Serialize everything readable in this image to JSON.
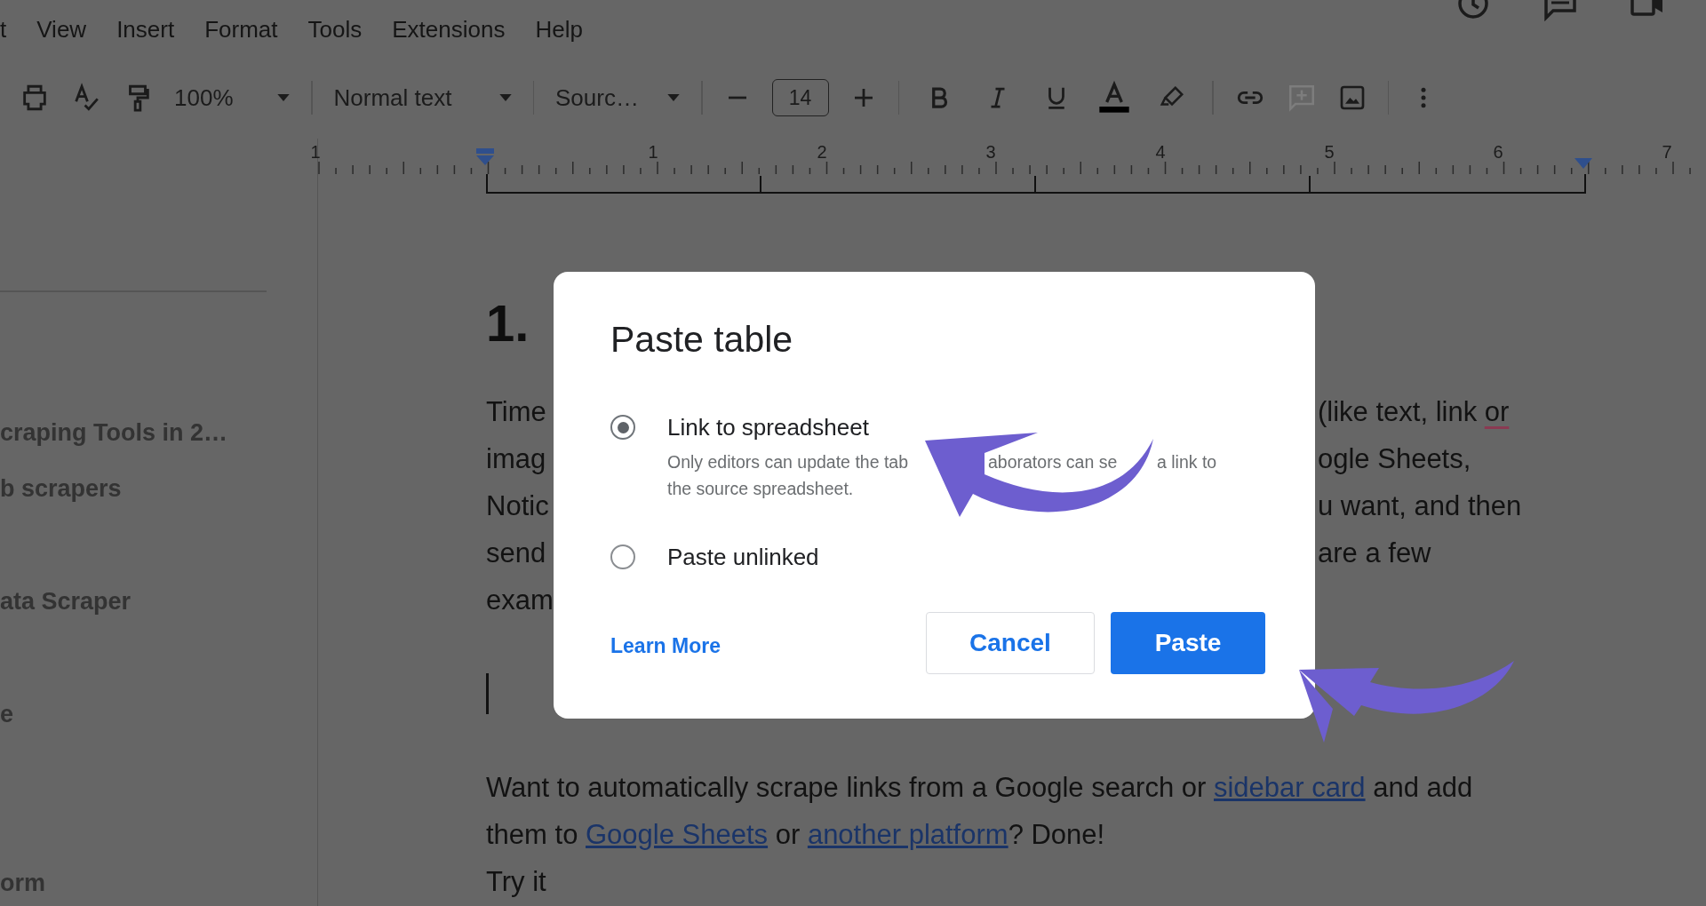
{
  "menu": [
    "t",
    "View",
    "Insert",
    "Format",
    "Tools",
    "Extensions",
    "Help"
  ],
  "toolbar": {
    "zoom": "100%",
    "style": "Normal text",
    "font": "Sourc…",
    "font_size": "14"
  },
  "ruler": {
    "labels": [
      "1",
      "1",
      "2",
      "3",
      "4",
      "5",
      "6",
      "7"
    ]
  },
  "outline": [
    "craping Tools in 2…",
    "b scrapers",
    "ata Scraper",
    "e",
    "orm"
  ],
  "document": {
    "heading": "1.",
    "covered_lines": [
      {
        "left": "Time",
        "right": [
          {
            "text": "(like text, link ",
            "misspelled": false
          },
          {
            "text": "or",
            "misspelled": true
          }
        ]
      },
      {
        "left": "imag",
        "right": [
          {
            "text": "ogle Sheets,",
            "misspelled": false
          }
        ]
      },
      {
        "left": "Notic",
        "right": [
          {
            "text": "u want, and then",
            "misspelled": false
          }
        ]
      },
      {
        "left": "send",
        "right": [
          {
            "text": "are a few",
            "misspelled": false
          }
        ]
      },
      {
        "left": "exam"
      }
    ],
    "lines": [
      [
        {
          "text": "Want to automatically scrape links from a Google search or ",
          "link": false
        },
        {
          "text": "sidebar card",
          "link": true
        },
        {
          "text": " and add",
          "link": false
        }
      ],
      [
        {
          "text": "them to ",
          "link": false
        },
        {
          "text": "Google Sheets",
          "link": true
        },
        {
          "text": " or ",
          "link": false
        },
        {
          "text": "another platform",
          "link": true
        },
        {
          "text": "? Done!",
          "link": false
        }
      ],
      [
        {
          "text": "Try it",
          "link": false
        }
      ]
    ]
  },
  "dialog": {
    "title": "Paste table",
    "options": [
      {
        "label": "Link to spreadsheet",
        "description_lines": [
          [
            "Only editors can update the tab",
            "aborators can se",
            "a link to"
          ],
          [
            "the source spreadsheet."
          ]
        ],
        "selected": true
      },
      {
        "label": "Paste unlinked",
        "selected": false
      }
    ],
    "learn_more": "Learn More",
    "cancel": "Cancel",
    "confirm": "Paste"
  }
}
